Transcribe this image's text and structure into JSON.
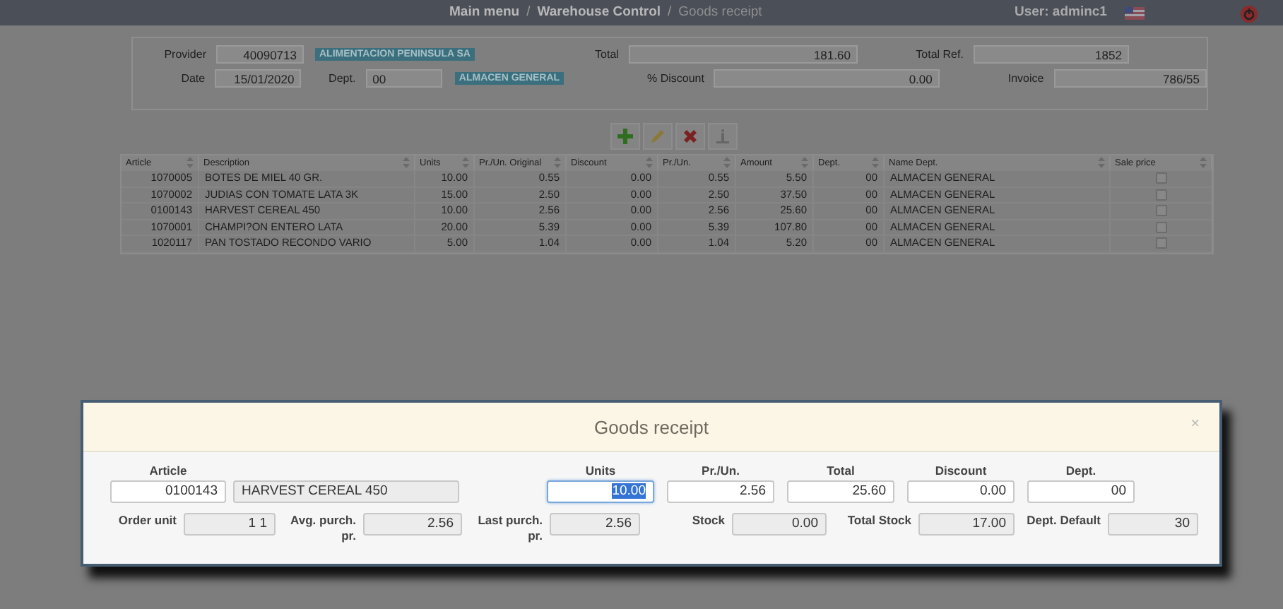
{
  "topbar": {
    "breadcrumb": [
      {
        "label": "Main menu",
        "current": false
      },
      {
        "label": "Warehouse Control",
        "current": false
      },
      {
        "label": "Goods receipt",
        "current": true
      }
    ],
    "separator": "/",
    "user": "User: adminc1"
  },
  "header": {
    "provider_label": "Provider",
    "provider": "40090713",
    "provider_name": "ALIMENTACION PENINSULA SA",
    "date_label": "Date",
    "date": "15/01/2020",
    "dept_label": "Dept.",
    "dept": "00",
    "dept_name": "ALMACEN GENERAL",
    "total_label": "Total",
    "total": "181.60",
    "discount_label": "% Discount",
    "discount": "0.00",
    "total_ref_label": "Total Ref.",
    "total_ref": "1852",
    "invoice_label": "Invoice",
    "invoice": "786/55"
  },
  "toolbar": [
    {
      "kind": "add"
    },
    {
      "kind": "edit"
    },
    {
      "kind": "delete"
    },
    {
      "kind": "info"
    }
  ],
  "table": {
    "columns": [
      "Article",
      "Description",
      "Units",
      "Pr./Un. Original",
      "Discount",
      "Pr./Un.",
      "Amount",
      "Dept.",
      "Name Dept.",
      "Sale price"
    ],
    "rows": [
      {
        "cells": [
          "1070005",
          "BOTES DE MIEL 40 GR.",
          "10.00",
          "0.55",
          "0.00",
          "0.55",
          "5.50",
          "00",
          "ALMACEN GENERAL"
        ],
        "sale_price": false
      },
      {
        "cells": [
          "1070002",
          "JUDIAS CON TOMATE LATA 3K",
          "15.00",
          "2.50",
          "0.00",
          "2.50",
          "37.50",
          "00",
          "ALMACEN GENERAL"
        ],
        "sale_price": false
      },
      {
        "cells": [
          "0100143",
          "HARVEST CEREAL 450",
          "10.00",
          "2.56",
          "0.00",
          "2.56",
          "25.60",
          "00",
          "ALMACEN GENERAL"
        ],
        "sale_price": false
      },
      {
        "cells": [
          "1070001",
          "CHAMPI?ON ENTERO LATA",
          "20.00",
          "5.39",
          "0.00",
          "5.39",
          "107.80",
          "00",
          "ALMACEN GENERAL"
        ],
        "sale_price": false
      },
      {
        "cells": [
          "1020117",
          "PAN TOSTADO RECONDO VARIO",
          "5.00",
          "1.04",
          "0.00",
          "1.04",
          "5.20",
          "00",
          "ALMACEN GENERAL"
        ],
        "sale_price": false
      }
    ]
  },
  "dialog": {
    "title": "Goods receipt",
    "close": "×",
    "article_label": "Article",
    "article": "0100143",
    "article_name": "HARVEST CEREAL 450",
    "inputs": [
      {
        "label": "Units",
        "value": "10.00",
        "focused": true
      },
      {
        "label": "Pr./Un.",
        "value": "2.56",
        "focused": false
      },
      {
        "label": "Total",
        "value": "25.60",
        "focused": false
      },
      {
        "label": "Discount",
        "value": "0.00",
        "focused": false
      },
      {
        "label": "Dept.",
        "value": "00",
        "focused": false
      }
    ],
    "info": [
      {
        "label": "Order unit",
        "value": "1 1"
      },
      {
        "label": "Avg. purch. pr.",
        "value": "2.56"
      },
      {
        "label": "Last purch. pr.",
        "value": "2.56"
      },
      {
        "label": "Stock",
        "value": "0.00"
      },
      {
        "label": "Total Stock",
        "value": "17.00"
      },
      {
        "label": "Dept. Default",
        "value": "30"
      }
    ]
  }
}
